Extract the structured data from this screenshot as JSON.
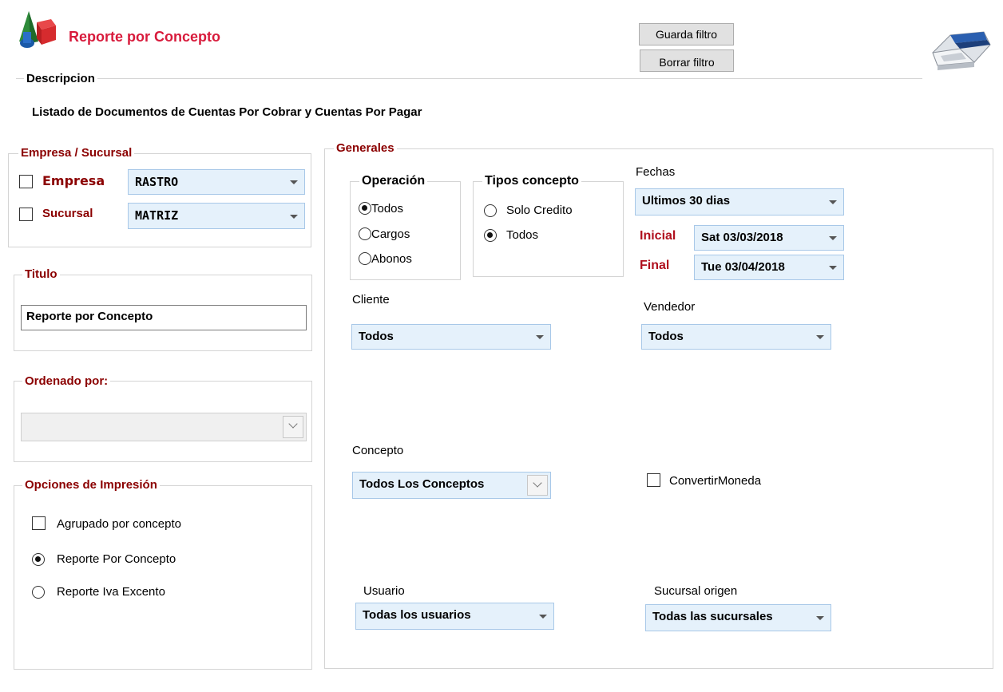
{
  "header": {
    "title": "Reporte por Concepto",
    "title_color": "#d81b3c",
    "app_icon": "shapes-icon",
    "save_filter_label": "Guarda filtro",
    "clear_filter_label": "Borrar filtro",
    "print_icon": "printer-icon"
  },
  "descripcion": {
    "legend": "Descripcion",
    "text": "Listado de Documentos de Cuentas Por Cobrar y Cuentas Por Pagar"
  },
  "empresa_sucursal": {
    "legend": "Empresa / Sucursal",
    "empresa_label": "Empresa",
    "empresa_checked": false,
    "empresa_value": "RASTRO",
    "sucursal_label": "Sucursal",
    "sucursal_checked": false,
    "sucursal_value": "MATRIZ"
  },
  "titulo": {
    "legend": "Titulo",
    "value": "Reporte por Concepto"
  },
  "ordenado": {
    "legend": "Ordenado por:",
    "value": ""
  },
  "opciones": {
    "legend": "Opciones de Impresión",
    "agrupado_label": "Agrupado por concepto",
    "agrupado_checked": false,
    "radio1_label": "Reporte Por Concepto",
    "radio1_selected": true,
    "radio2_label": "Reporte Iva Excento",
    "radio2_selected": false
  },
  "generales": {
    "legend": "Generales",
    "operacion": {
      "legend": "Operación",
      "options": [
        "Todos",
        "Cargos",
        "Abonos"
      ],
      "selected": "Todos"
    },
    "tipos": {
      "legend": "Tipos concepto",
      "options": [
        "Solo Credito",
        "Todos"
      ],
      "selected": "Todos"
    },
    "fechas": {
      "label": "Fechas",
      "range_value": "Ultimos 30 dias",
      "inicial_label": "Inicial",
      "inicial_value": "Sat 03/03/2018",
      "final_label": "Final",
      "final_value": "Tue 03/04/2018"
    },
    "cliente": {
      "label": "Cliente",
      "value": "Todos"
    },
    "vendedor": {
      "label": "Vendedor",
      "value": "Todos"
    },
    "concepto": {
      "label": "Concepto",
      "value": "Todos Los Conceptos"
    },
    "convertir": {
      "label": "ConvertirMoneda",
      "checked": false
    },
    "usuario": {
      "label": "Usuario",
      "value": "Todas los usuarios"
    },
    "sucursal_origen": {
      "label": "Sucursal origen",
      "value": "Todas las sucursales"
    }
  }
}
